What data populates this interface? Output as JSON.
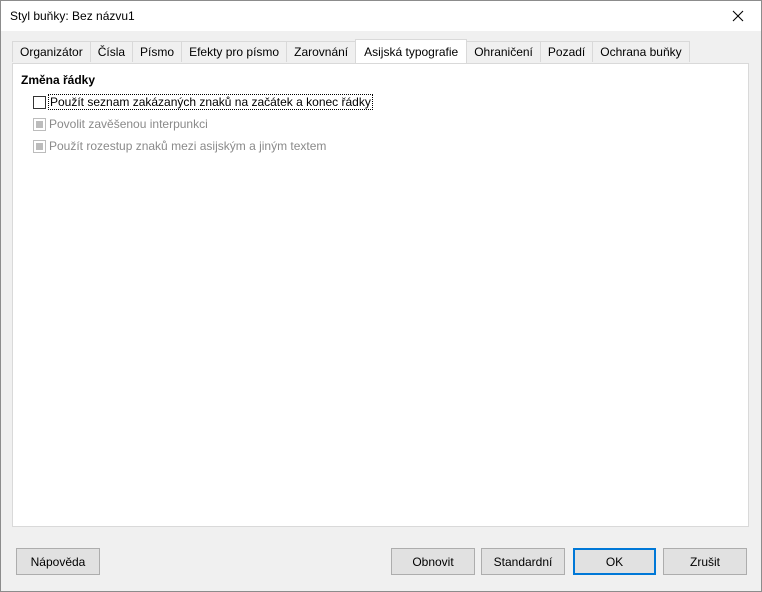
{
  "window": {
    "title": "Styl buňky: Bez názvu1"
  },
  "tabs": [
    {
      "label": "Organizátor"
    },
    {
      "label": "Čísla"
    },
    {
      "label": "Písmo"
    },
    {
      "label": "Efekty pro písmo"
    },
    {
      "label": "Zarovnání"
    },
    {
      "label": "Asijská typografie"
    },
    {
      "label": "Ohraničení"
    },
    {
      "label": "Pozadí"
    },
    {
      "label": "Ochrana buňky"
    }
  ],
  "active_tab": "Asijská typografie",
  "panel": {
    "section_title": "Změna řádky",
    "options": [
      {
        "label": "Použít seznam zakázaných znaků na začátek a konec řádky",
        "checked": false,
        "enabled": true
      },
      {
        "label": "Povolit zavěšenou interpunkci",
        "checked": "mixed",
        "enabled": false
      },
      {
        "label": "Použít rozestup znaků mezi asijským a jiným textem",
        "checked": "mixed",
        "enabled": false
      }
    ]
  },
  "buttons": {
    "help": "Nápověda",
    "reset": "Obnovit",
    "standard": "Standardní",
    "ok": "OK",
    "cancel": "Zrušit"
  }
}
